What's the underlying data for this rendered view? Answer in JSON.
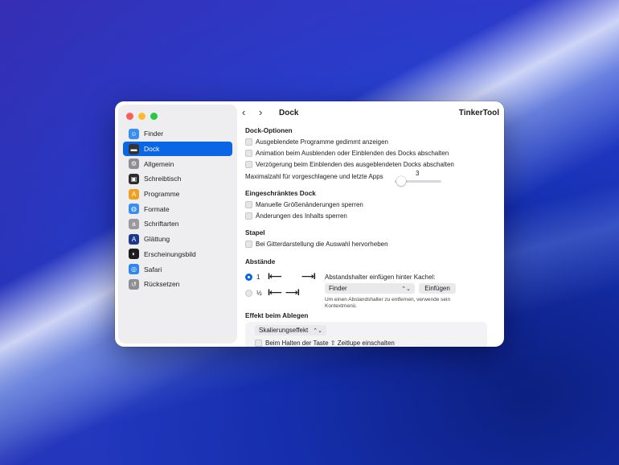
{
  "sidebar": {
    "items": [
      {
        "label": "Finder",
        "icon": "finder-icon",
        "color": "#3a8ef0"
      },
      {
        "label": "Dock",
        "icon": "dock-icon",
        "color": "#333333"
      },
      {
        "label": "Allgemein",
        "icon": "general-icon",
        "color": "#8e8e93"
      },
      {
        "label": "Schreibtisch",
        "icon": "desktop-icon",
        "color": "#2c2c2e"
      },
      {
        "label": "Programme",
        "icon": "applications-icon",
        "color": "#f0a020"
      },
      {
        "label": "Formate",
        "icon": "globe-icon",
        "color": "#3a8ef0"
      },
      {
        "label": "Schriftarten",
        "icon": "fonts-icon",
        "color": "#9a9a9e"
      },
      {
        "label": "Glättung",
        "icon": "smoothing-icon",
        "color": "#1d3a8a"
      },
      {
        "label": "Erscheinungsbild",
        "icon": "appearance-icon",
        "color": "#1d1d1f"
      },
      {
        "label": "Safari",
        "icon": "safari-icon",
        "color": "#2f86f0"
      },
      {
        "label": "Rücksetzen",
        "icon": "reset-icon",
        "color": "#8e8e93"
      }
    ],
    "active_index": 1
  },
  "toolbar": {
    "back": "‹",
    "forward": "›",
    "title": "Dock",
    "app_name": "TinkerTool"
  },
  "dock_options": {
    "heading": "Dock-Optionen",
    "opt1": "Ausgeblendete Programme gedimmt anzeigen",
    "opt2": "Animation beim Ausblenden oder Einblenden des Docks abschalten",
    "opt3": "Verzögerung beim Einblenden des ausgeblendeten Docks abschalten",
    "max_label": "Maximalzahl für vorgeschlagene und letzte Apps",
    "max_value": "3"
  },
  "restricted": {
    "heading": "Eingeschränktes Dock",
    "opt1": "Manuelle Größenänderungen sperren",
    "opt2": "Änderungen des Inhalts sperren"
  },
  "stacks": {
    "heading": "Stapel",
    "opt1": "Bei Gitterdarstellung die Auswahl hervorheben"
  },
  "spacing": {
    "heading": "Abstände",
    "radio1": "1",
    "radio2": "½",
    "arrow_left": "I⟵",
    "arrow_right": "⟶I",
    "insert_label": "Abstandshalter einfügen hinter Kachel:",
    "popup_value": "Finder",
    "insert_button": "Einfügen",
    "note": "Um einen Abstandshalter zu entfernen, verwende sein Kontextmenü."
  },
  "drop_effect": {
    "heading": "Effekt beim Ablegen",
    "popup_value": "Skalierungseffekt",
    "opt1": "Beim Halten der Taste ⇧ Zeitlupe einschalten"
  }
}
